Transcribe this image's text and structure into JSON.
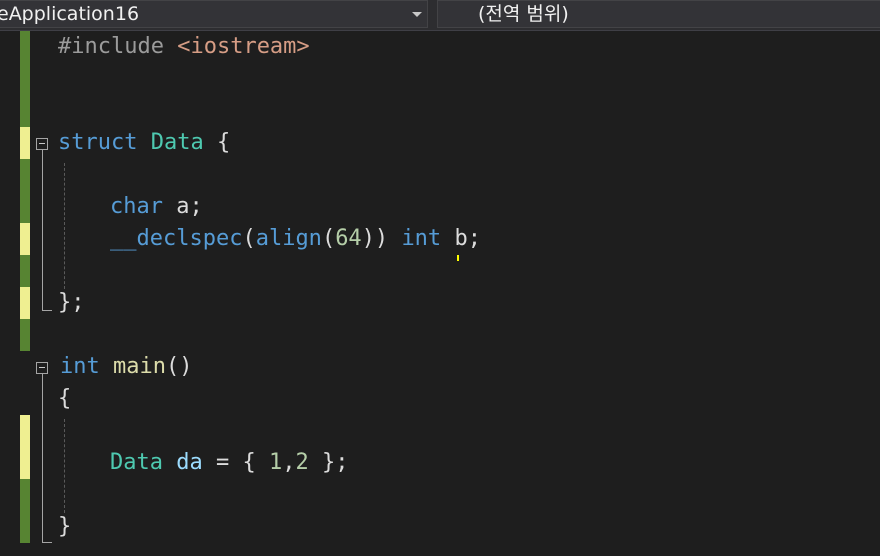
{
  "navbar": {
    "project_label": "eApplication16",
    "scope_label": "(전역 범위)"
  },
  "code": {
    "line1": {
      "directive": "#include",
      "path": "<iostream>"
    },
    "line2": {
      "kw": "struct",
      "type": "Data",
      "brace": "{"
    },
    "line3": {
      "kw": "char",
      "ident": "a;"
    },
    "line4": {
      "fn": "__declspec",
      "p1": "(",
      "attr": "align",
      "p2": "(",
      "num": "64",
      "p3": "))",
      "kw": "int",
      "ident": "b",
      "semi": ";"
    },
    "line5": {
      "text": "};"
    },
    "line6": {
      "kw": "int",
      "fn": "main",
      "paren": "()"
    },
    "line7": {
      "text": "{"
    },
    "line8": {
      "type": "Data",
      "ident": "da",
      "rest1": "= { ",
      "n1": "1",
      "comma": ",",
      "n2": "2",
      "rest2": " };"
    },
    "line9": {
      "text": "}"
    }
  },
  "colors": {
    "saved_change": "#578432",
    "unsaved_change": "#efef91",
    "keyword": "#569cd6",
    "type": "#4ec9b0",
    "function": "#dcdcaa",
    "number": "#b5cea8"
  }
}
